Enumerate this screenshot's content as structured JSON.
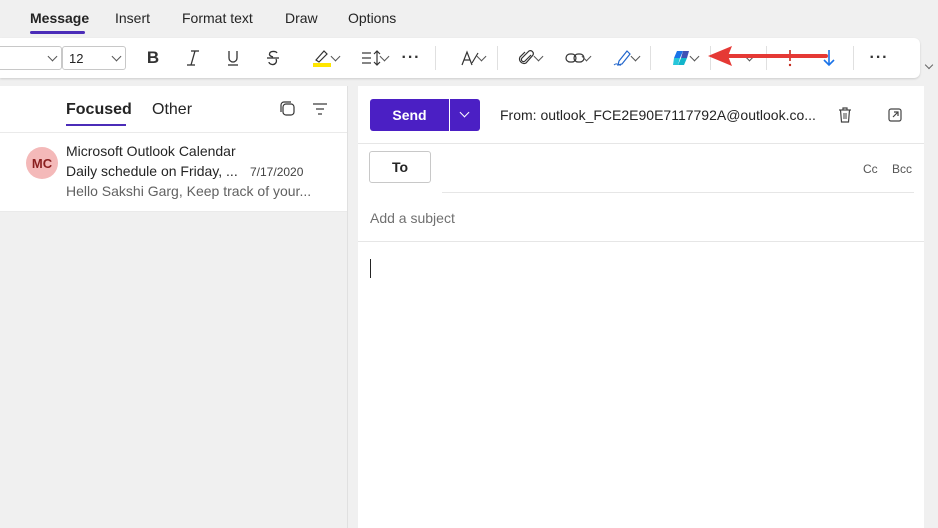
{
  "tabs": {
    "message": "Message",
    "insert": "Insert",
    "format_text": "Format text",
    "draw": "Draw",
    "options": "Options"
  },
  "ribbon": {
    "font_size": "12",
    "more": "···"
  },
  "mail_list": {
    "focused": "Focused",
    "other": "Other",
    "items": [
      {
        "initials": "MC",
        "sender": "Microsoft Outlook Calendar",
        "subject": "Daily schedule on Friday, ...",
        "date": "7/17/2020",
        "preview": "Hello Sakshi Garg, Keep track of your..."
      }
    ]
  },
  "compose": {
    "send": "Send",
    "from": "From: outlook_FCE2E90E7117792A@outlook.co...",
    "to": "To",
    "cc": "Cc",
    "bcc": "Bcc",
    "subject_placeholder": "Add a subject",
    "subject_value": ""
  },
  "colors": {
    "accent": "#4b1fc4",
    "highlight": "#ffe600",
    "annotation_arrow": "#e53935",
    "avatar_bg": "#f4b9b9"
  }
}
